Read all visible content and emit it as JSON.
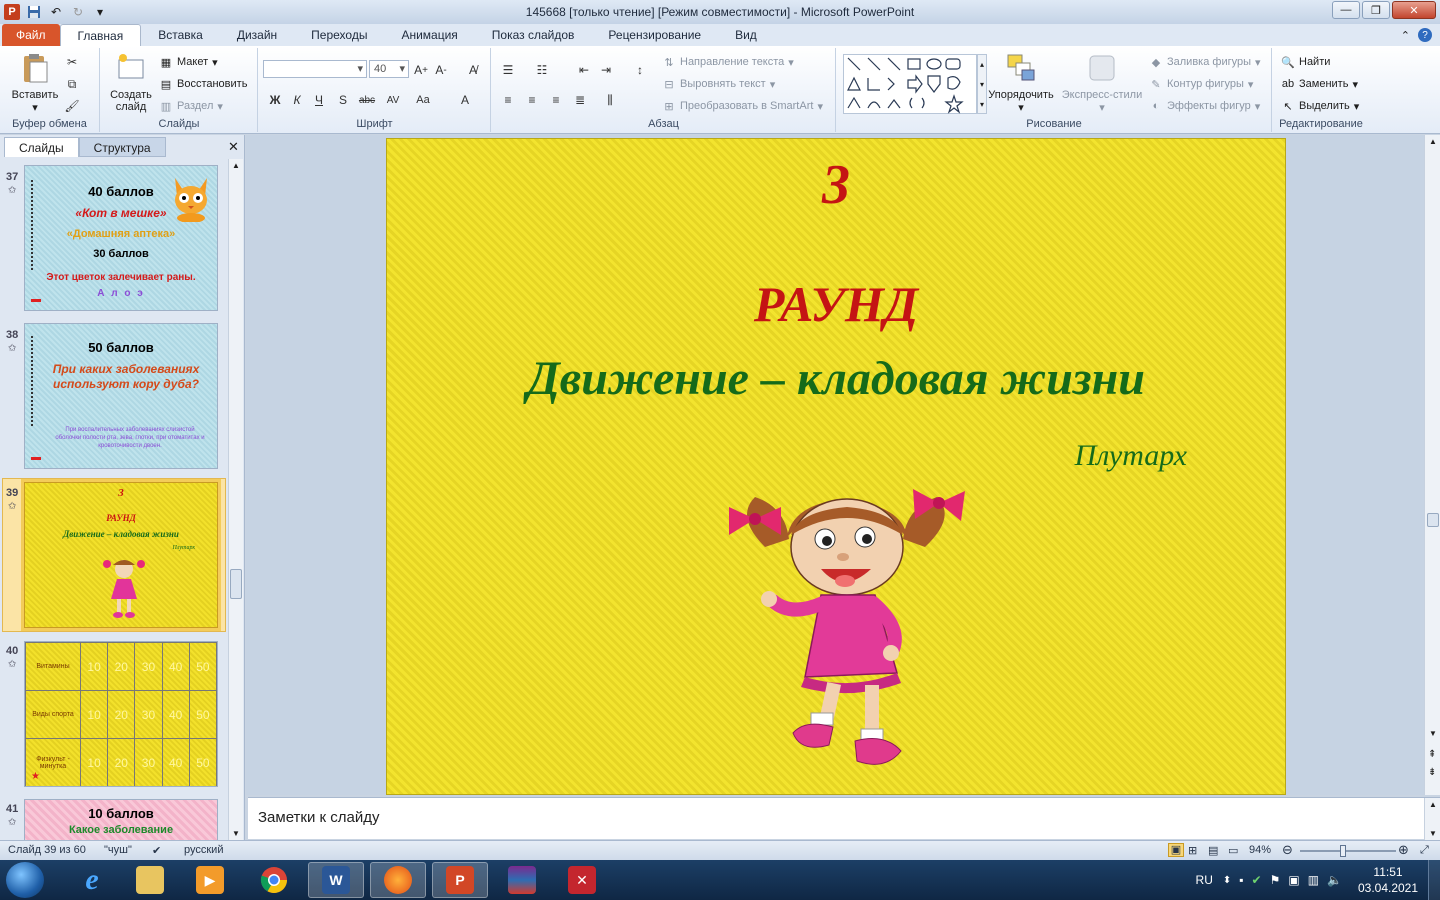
{
  "window": {
    "title": "145668 [только чтение] [Режим совместимости] - Microsoft PowerPoint",
    "app_icon": "P"
  },
  "ribbon_tabs": [
    "Файл",
    "Главная",
    "Вставка",
    "Дизайн",
    "Переходы",
    "Анимация",
    "Показ слайдов",
    "Рецензирование",
    "Вид"
  ],
  "ribbon": {
    "clipboard": {
      "paste": "Вставить",
      "label": "Буфер обмена"
    },
    "slides": {
      "create": "Создать слайд",
      "layout": "Макет",
      "reset": "Восстановить",
      "section": "Раздел",
      "label": "Слайды"
    },
    "font": {
      "size": "40",
      "label": "Шрифт"
    },
    "paragraph": {
      "text_direction": "Направление текста",
      "align_text": "Выровнять текст",
      "smartart": "Преобразовать в SmartArt",
      "label": "Абзац"
    },
    "drawing": {
      "arrange": "Упорядочить",
      "quick_styles": "Экспресс-стили",
      "fill": "Заливка фигуры",
      "outline": "Контур фигуры",
      "effects": "Эффекты фигур",
      "label": "Рисование"
    },
    "editing": {
      "find": "Найти",
      "replace": "Заменить",
      "select": "Выделить",
      "label": "Редактирование"
    }
  },
  "left_panel": {
    "tabs": [
      "Слайды",
      "Структура"
    ],
    "thumbnails": [
      {
        "num": "37",
        "lines": [
          "40 баллов",
          "«Кот в мешке»",
          "«Домашняя аптека»",
          "30 баллов",
          "Этот цветок залечивает раны.",
          "А л о э"
        ]
      },
      {
        "num": "38",
        "lines": [
          "50 баллов",
          "При каких заболеваниях используют кору дуба?",
          "При воспалительных заболеваниях слизистой оболочки полости рта, зева, глотки, при отоматитах и кровоточивости двоен."
        ]
      },
      {
        "num": "39",
        "lines": [
          "3",
          "РАУНД",
          "Движение – кладовая жизни",
          "Плутарх"
        ]
      },
      {
        "num": "40",
        "rows": [
          "Витамины",
          "Виды спорта",
          "Физкульт - минутка"
        ],
        "cols": [
          "10",
          "20",
          "30",
          "40",
          "50"
        ]
      },
      {
        "num": "41",
        "lines": [
          "10 баллов",
          "Какое заболевание"
        ]
      }
    ]
  },
  "slide": {
    "number": "3",
    "round": "РАУНД",
    "title": "Движение – кладовая жизни",
    "author": "Плутарх"
  },
  "notes": {
    "placeholder": "Заметки к слайду"
  },
  "status": {
    "slide_info": "Слайд 39 из 60",
    "theme": "\"чуш\"",
    "language": "русский",
    "zoom": "94%"
  },
  "taskbar": {
    "lang": "RU",
    "time": "11:51",
    "date": "03.04.2021"
  }
}
